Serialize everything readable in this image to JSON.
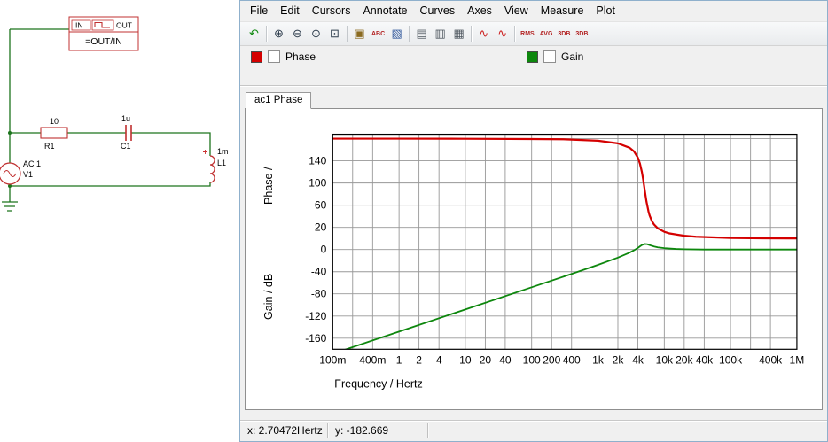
{
  "window": {
    "menu": [
      "File",
      "Edit",
      "Cursors",
      "Annotate",
      "Curves",
      "Axes",
      "View",
      "Measure",
      "Plot"
    ],
    "toolbar": {
      "items": [
        {
          "name": "undo-icon",
          "glyph": "↶",
          "color": "#128a12"
        },
        {
          "sep": true
        },
        {
          "name": "zoom-in-icon",
          "glyph": "⊕",
          "color": "#2f3e4e"
        },
        {
          "name": "zoom-out-icon",
          "glyph": "⊖",
          "color": "#2f3e4e"
        },
        {
          "name": "zoom-full-icon",
          "glyph": "⊙",
          "color": "#2f3e4e"
        },
        {
          "name": "zoom-rect-icon",
          "glyph": "⊡",
          "color": "#2f3e4e"
        },
        {
          "sep": true
        },
        {
          "name": "copy-graph-icon",
          "glyph": "▣",
          "color": "#8a6a20"
        },
        {
          "name": "annotate-label-icon",
          "text": "ABC",
          "color": "#b22222"
        },
        {
          "name": "add-axis-icon",
          "glyph": "▧",
          "color": "#3a5fa0"
        },
        {
          "sep": true
        },
        {
          "name": "grid-horizontal-icon",
          "glyph": "▤",
          "color": "#4d565e"
        },
        {
          "name": "grid-vertical-icon",
          "glyph": "▥",
          "color": "#4d565e"
        },
        {
          "name": "grid-both-icon",
          "glyph": "▦",
          "color": "#4d565e"
        },
        {
          "sep": true
        },
        {
          "name": "rising-edge-icon",
          "glyph": "∿",
          "color": "#cc2222"
        },
        {
          "name": "falling-edge-icon",
          "glyph": "∿",
          "color": "#cc2222"
        },
        {
          "sep": true
        },
        {
          "name": "rms-button",
          "text": "RMS",
          "color": "#b22222"
        },
        {
          "name": "avg-button",
          "text": "AVG",
          "color": "#b22222"
        },
        {
          "name": "db3-first-button",
          "text": "3DB",
          "color": "#b22222"
        },
        {
          "name": "db3-second-button",
          "text": "3DB",
          "color": "#b22222"
        }
      ]
    },
    "legend": [
      {
        "label": "Phase",
        "color": "#d40000",
        "checked": false
      },
      {
        "label": "Gain",
        "color": "#0d870d",
        "checked": false
      }
    ],
    "tab": "ac1 Phase",
    "statusbar": {
      "x": "x: 2.70472Hertz",
      "y": "y: -182.669"
    }
  },
  "circuit": {
    "probe": {
      "in": "IN",
      "out": "OUT",
      "formula": "=OUT/IN"
    },
    "components": {
      "r1": {
        "value": "10",
        "name": "R1"
      },
      "c1": {
        "value": "1u",
        "name": "C1"
      },
      "l1": {
        "value": "1m",
        "name": "L1"
      },
      "v1": {
        "value": "AC 1",
        "name": "V1"
      }
    },
    "wire_color": "#1c741c",
    "symbol_color": "#c03030"
  },
  "chart_data": {
    "type": "line",
    "x_scale": "log",
    "xlim": [
      0.1,
      1000000
    ],
    "xlabel": "Frequency / Hertz",
    "x_ticks": [
      [
        "100m",
        0.1
      ],
      [
        "400m",
        0.4
      ],
      [
        "1",
        1
      ],
      [
        "2",
        2
      ],
      [
        "4",
        4
      ],
      [
        "10",
        10
      ],
      [
        "20",
        20
      ],
      [
        "40",
        40
      ],
      [
        "100",
        100
      ],
      [
        "200",
        200
      ],
      [
        "400",
        400
      ],
      [
        "1k",
        1000
      ],
      [
        "2k",
        2000
      ],
      [
        "4k",
        4000
      ],
      [
        "10k",
        10000
      ],
      [
        "20k",
        20000
      ],
      [
        "40k",
        40000
      ],
      [
        "100k",
        100000
      ],
      [
        "400k",
        400000
      ],
      [
        "1M",
        1000000
      ]
    ],
    "x_gridlines": [
      0.2,
      0.4,
      1,
      2,
      4,
      10,
      20,
      40,
      100,
      200,
      400,
      1000,
      2000,
      4000,
      10000,
      20000,
      40000,
      100000,
      200000,
      400000
    ],
    "ylim_units": [
      -200,
      188
    ],
    "grid_units": [
      180,
      140,
      100,
      60,
      20,
      -20,
      -60,
      -100,
      -140,
      -180
    ],
    "axes": [
      {
        "name": "phase",
        "label": "Phase /",
        "ticks": [
          140,
          100,
          60,
          20
        ],
        "unit_offset": 0,
        "label_center_unit": 95
      },
      {
        "name": "gain",
        "label": "Gain / dB",
        "ticks": [
          0,
          -40,
          -80,
          -120,
          -160
        ],
        "unit_offset": -20,
        "label_center_unit": -105
      }
    ],
    "colors": {
      "grid": "#989898",
      "border": "#000000",
      "background": "#ffffff"
    },
    "series": [
      {
        "name": "Phase",
        "color": "#d40000",
        "width": 2.2,
        "unit_offset": 0,
        "points": [
          [
            0.1,
            180
          ],
          [
            1,
            180
          ],
          [
            10,
            179.9
          ],
          [
            100,
            179.3
          ],
          [
            300,
            178.9
          ],
          [
            1000,
            176.3
          ],
          [
            2000,
            171.5
          ],
          [
            3000,
            163.7
          ],
          [
            3500,
            156.9
          ],
          [
            4000,
            145.7
          ],
          [
            4300,
            135
          ],
          [
            4600,
            119.7
          ],
          [
            4800,
            106.7
          ],
          [
            5000,
            92.4
          ],
          [
            5200,
            78.3
          ],
          [
            5400,
            66
          ],
          [
            5800,
            48
          ],
          [
            6000,
            41.8
          ],
          [
            6500,
            31.4
          ],
          [
            7000,
            25.2
          ],
          [
            8000,
            18.2
          ],
          [
            10000,
            12
          ],
          [
            12000,
            9.1
          ],
          [
            20000,
            4.9
          ],
          [
            30000,
            3.1
          ],
          [
            100000,
            0.9
          ],
          [
            300000,
            0.3
          ],
          [
            1000000,
            0.1
          ]
        ]
      },
      {
        "name": "Gain",
        "color": "#0d870d",
        "width": 1.8,
        "unit_offset": -20,
        "points": [
          [
            0.1,
            -188.1
          ],
          [
            1,
            -148.1
          ],
          [
            10,
            -108.1
          ],
          [
            100,
            -68.1
          ],
          [
            400,
            -44
          ],
          [
            1000,
            -27.7
          ],
          [
            2000,
            -14.6
          ],
          [
            3000,
            -5.5
          ],
          [
            3500,
            -1.3
          ],
          [
            4000,
            3.0
          ],
          [
            4300,
            5.6
          ],
          [
            4600,
            8.0
          ],
          [
            5033,
            10.0
          ],
          [
            5500,
            9.6
          ],
          [
            6000,
            8.0
          ],
          [
            6500,
            6.6
          ],
          [
            7000,
            5.5
          ],
          [
            8000,
            3.9
          ],
          [
            10000,
            2.4
          ],
          [
            15000,
            1.0
          ],
          [
            20000,
            0.5
          ],
          [
            40000,
            0.1
          ],
          [
            100000,
            0.0
          ],
          [
            1000000,
            0.0
          ]
        ]
      }
    ]
  }
}
